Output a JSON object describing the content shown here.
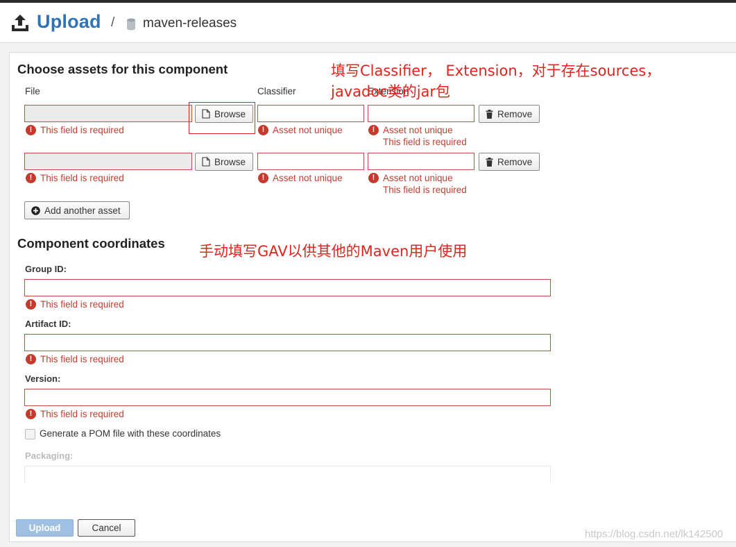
{
  "header": {
    "title": "Upload",
    "separator": "/",
    "repository": "maven-releases"
  },
  "assets": {
    "section_title": "Choose assets for this component",
    "columns": {
      "file": "File",
      "classifier": "Classifier",
      "extension": "Extension"
    },
    "browse_label": "Browse",
    "remove_label": "Remove",
    "add_label": "Add another asset",
    "rows": [
      {
        "file_value": "",
        "classifier_value": "",
        "extension_value": "",
        "file_error": "This field is required",
        "classifier_error": "Asset not unique",
        "extension_error": "Asset not unique",
        "extension_error2": "This field is required"
      },
      {
        "file_value": "",
        "classifier_value": "",
        "extension_value": "",
        "file_error": "This field is required",
        "classifier_error": "Asset not unique",
        "extension_error": "Asset not unique",
        "extension_error2": "This field is required"
      }
    ]
  },
  "coordinates": {
    "section_title": "Component coordinates",
    "group_label": "Group ID:",
    "group_value": "",
    "group_error": "This field is required",
    "artifact_label": "Artifact ID:",
    "artifact_value": "",
    "artifact_error": "This field is required",
    "version_label": "Version:",
    "version_value": "",
    "version_error": "This field is required",
    "pom_label": "Generate a POM file with these coordinates",
    "packaging_label": "Packaging:"
  },
  "footer": {
    "upload_label": "Upload",
    "cancel_label": "Cancel"
  },
  "annotations": {
    "note1_line1": "填写Classifier， Extension，对于存在sources，",
    "note1_line2": "javadoc类的jar包",
    "note2": "手动填写GAV以供其他的Maven用户使用"
  },
  "watermark": "https://blog.csdn.net/lk142500",
  "colors": {
    "brand": "#2f74b5",
    "error": "#c33d31",
    "annotation": "#e1241b",
    "primary_disabled": "#9fc0e2"
  },
  "icons": {
    "header": "upload-icon",
    "repository": "database-icon",
    "browse": "file-icon",
    "remove": "trash-icon",
    "add": "plus-circle-icon",
    "error": "exclamation-circle-icon"
  }
}
